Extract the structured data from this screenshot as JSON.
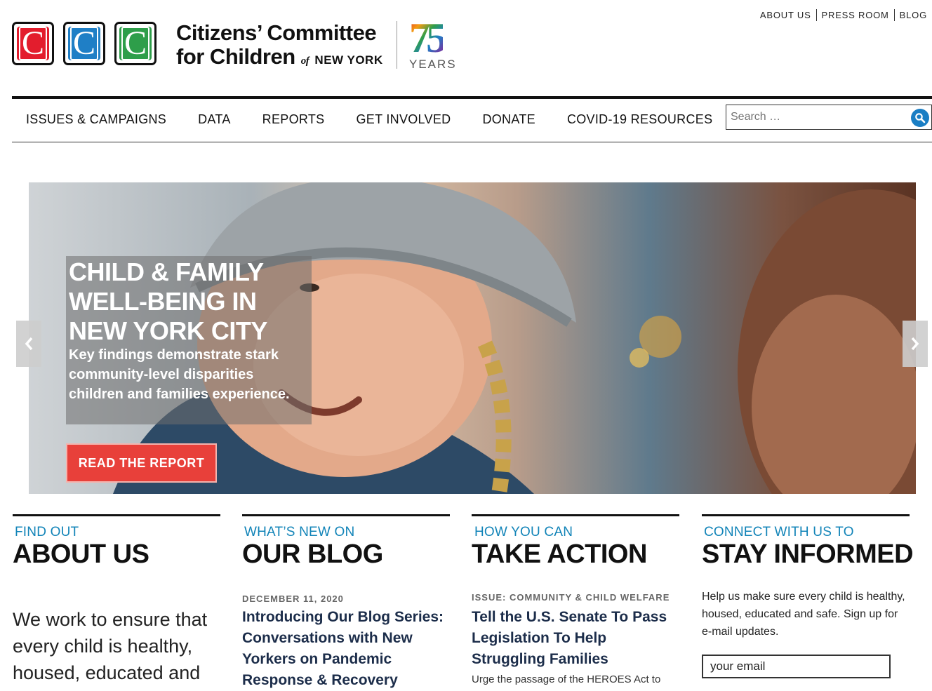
{
  "header": {
    "logo_letters": [
      "C",
      "C",
      "C"
    ],
    "logo_colors": [
      "#e31d2d",
      "#1f7fc6",
      "#2e9e4a"
    ],
    "org_line1": "Citizens’ Committee",
    "org_line2": "for Children",
    "org_of": "of",
    "org_city": "NEW YORK",
    "anniversary_number": "75",
    "anniversary_word": "YEARS",
    "top_links": [
      "ABOUT US",
      "PRESS ROOM",
      "BLOG"
    ]
  },
  "nav": {
    "items": [
      "ISSUES & CAMPAIGNS",
      "DATA",
      "REPORTS",
      "GET INVOLVED",
      "DONATE",
      "COVID-19 RESOURCES"
    ]
  },
  "search": {
    "placeholder": "Search …"
  },
  "hero": {
    "title": "CHILD & FAMILY WELL-BEING IN NEW YORK CITY",
    "subtitle": "Key findings demonstrate stark community-level disparities children and families experience.",
    "button": "READ THE REPORT",
    "prev_icon": "chevron-left-icon",
    "next_icon": "chevron-right-icon"
  },
  "columns": {
    "about": {
      "kicker": "FIND OUT",
      "heading": "ABOUT US",
      "text": "We work to ensure that every child is healthy, housed, educated and"
    },
    "blog": {
      "kicker": "WHAT’S NEW ON",
      "heading": "OUR BLOG",
      "date": "DECEMBER 11, 2020",
      "title": "Introducing Our Blog Series: Conversations with New Yorkers on Pandemic Response & Recovery"
    },
    "action": {
      "kicker": "HOW YOU CAN",
      "heading": "TAKE ACTION",
      "issue": "ISSUE: COMMUNITY & CHILD WELFARE",
      "title": "Tell the U.S. Senate To Pass Legislation To Help Struggling Families",
      "desc": "Urge the passage of the HEROES Act to"
    },
    "inform": {
      "kicker": "CONNECT WITH US TO",
      "heading": "STAY INFORMED",
      "text": "Help us make sure every child is healthy, housed, educated and safe. Sign up for e-mail updates.",
      "email_placeholder": "your email"
    }
  },
  "colors": {
    "accent_blue": "#1284b8",
    "button_red": "#e8403a",
    "title_navy": "#1c2d4a"
  }
}
